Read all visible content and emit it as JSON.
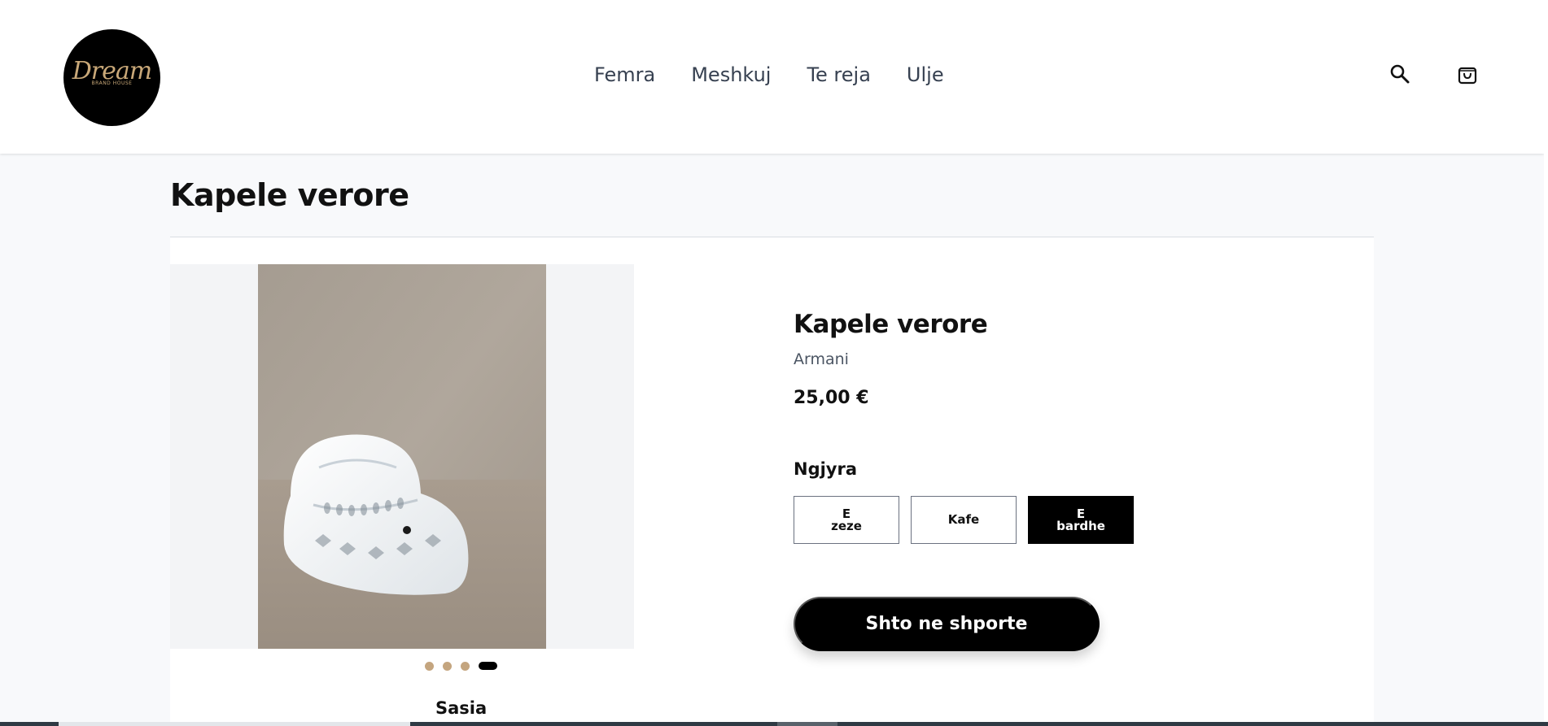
{
  "header": {
    "logo": {
      "script": "Dream",
      "sub": "BRAND HOUSE"
    },
    "nav": [
      {
        "label": "Femra"
      },
      {
        "label": "Meshkuj"
      },
      {
        "label": "Te reja"
      },
      {
        "label": "Ulje"
      }
    ],
    "icons": {
      "search": "search-icon",
      "cart": "shopping-bag-icon"
    }
  },
  "page": {
    "title": "Kapele verore"
  },
  "gallery": {
    "image": "white-crochet-cowboy-hat",
    "dots_count": 4,
    "active_dot": 4,
    "size_label": "Sasia"
  },
  "product": {
    "title": "Kapele verore",
    "brand": "Armani",
    "price": "25,00 €",
    "color_label": "Ngjyra",
    "colors": [
      {
        "label": "E zeze",
        "selected": false
      },
      {
        "label": "Kafe",
        "selected": false
      },
      {
        "label": "E bardhe",
        "selected": true
      }
    ],
    "add_to_cart": "Shto ne shporte"
  },
  "theme": {
    "accent": "#000000",
    "dot_color": "#c4a57f",
    "logo_gold": "#c9a878"
  }
}
